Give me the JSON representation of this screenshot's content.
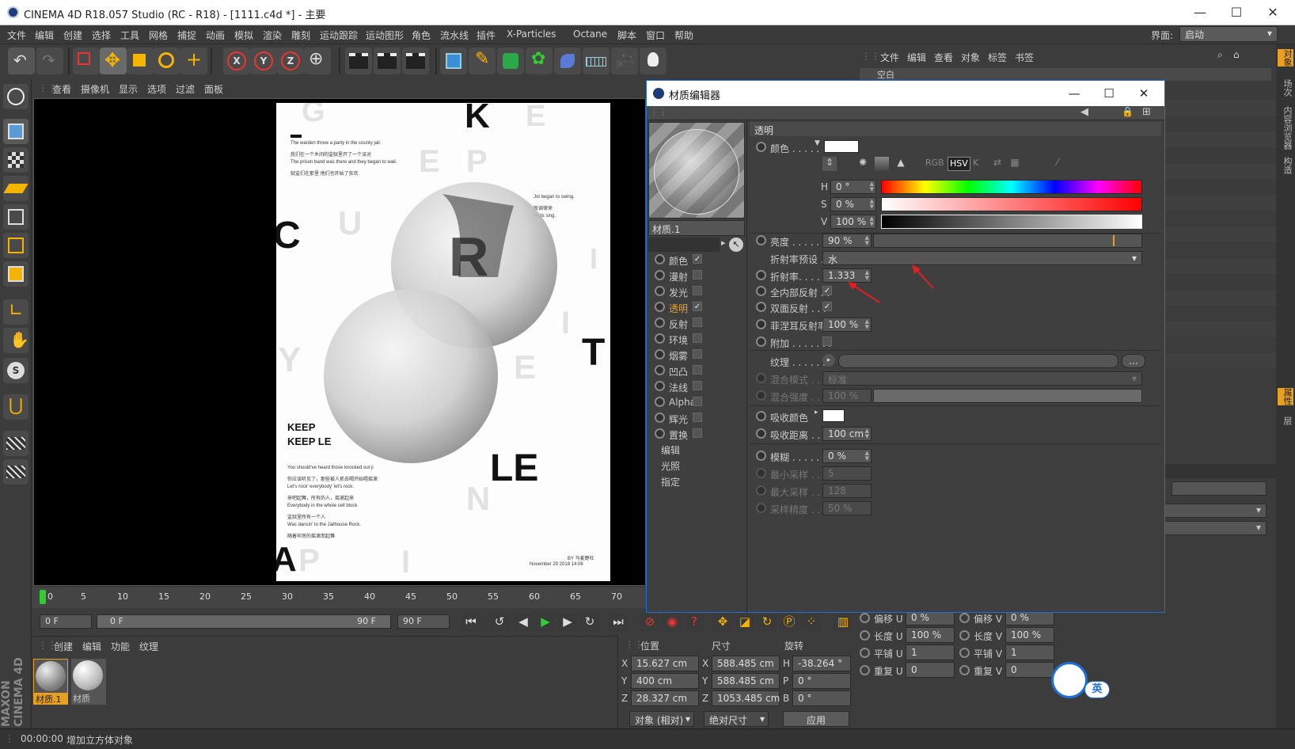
{
  "app": {
    "title": "CINEMA 4D R18.057 Studio (RC - R18) - [1111.c4d *] - 主要",
    "min": "—",
    "max": "☐",
    "close": "✕"
  },
  "menu": [
    "文件",
    "编辑",
    "创建",
    "选择",
    "工具",
    "网格",
    "捕捉",
    "动画",
    "模拟",
    "渲染",
    "雕刻",
    "运动跟踪",
    "运动图形",
    "角色",
    "流水线",
    "插件",
    "X-Particles",
    "Octane",
    "脚本",
    "窗口",
    "帮助"
  ],
  "layout": {
    "label": "界面:",
    "value": "启动"
  },
  "viewport_menu": [
    "查看",
    "摄像机",
    "显示",
    "选项",
    "过滤",
    "面板"
  ],
  "poster": {
    "small_text_1": [
      "The warden threw a party in the county jail.",
      "我们在一个乡间的监狱里开了一个派对",
      "The prison band was there and they began to wail.",
      "狱监们在那里 他们也开始了狂欢"
    ],
    "small_text_2": [
      "Jot began to swing.",
      "般调律来",
      "Birds sing."
    ],
    "headline": [
      "KEEP",
      "KEEP LE"
    ],
    "small_text_3": [
      "You should've heard those knocked out ji",
      "你应该听见了，那些被人抓去喝开始唱摇滚",
      "Let's rock' everybody' let's rock.",
      "来吧起舞，所有的人，摇滚起来",
      "Everybody in the whole cell block",
      "监狱里所有一个人",
      "Was dancin' to the Jailhouse Rock.",
      "随着牢房的摇滚而起舞"
    ],
    "credit": [
      "BY 马麦野社",
      "November 29 2018 14:06"
    ],
    "letters_dark": [
      "K",
      "C",
      "R",
      "T",
      "LE"
    ],
    "letters_light": [
      "G",
      "E",
      "E",
      "P",
      "U",
      "Y",
      "E",
      "N",
      "I",
      "A",
      "P",
      "I",
      "I"
    ]
  },
  "timeline": {
    "ticks": [
      "0",
      "5",
      "10",
      "15",
      "20",
      "25",
      "30",
      "35",
      "40",
      "45",
      "50",
      "55",
      "60",
      "65",
      "70"
    ],
    "current_frame": "0 F",
    "range_start": "0 F",
    "range_end": "90 F",
    "end_frame": "90 F"
  },
  "material_manager": {
    "menu": [
      "创建",
      "编辑",
      "功能",
      "纹理"
    ],
    "materials": [
      "材质.1",
      "材质"
    ]
  },
  "coords": {
    "headers": [
      "位置",
      "尺寸",
      "旋转"
    ],
    "rows": [
      {
        "a": "X",
        "pos": "15.627 cm",
        "b": "X",
        "size": "588.485 cm",
        "c": "H",
        "rot": "-38.264 °"
      },
      {
        "a": "Y",
        "pos": "400 cm",
        "b": "Y",
        "size": "588.485 cm",
        "c": "P",
        "rot": "0 °"
      },
      {
        "a": "Z",
        "pos": "28.327 cm",
        "b": "Z",
        "size": "1053.485 cm",
        "c": "B",
        "rot": "0 °"
      }
    ],
    "mode": "对象 (相对)",
    "size_mode": "绝对尺寸",
    "apply": "应用"
  },
  "status": {
    "time": "00:00:00",
    "message": "增加立方体对象"
  },
  "object_manager": {
    "menu": [
      "文件",
      "编辑",
      "查看",
      "对象",
      "标签",
      "书签"
    ],
    "item": "空白"
  },
  "uv": {
    "rows": [
      {
        "l1": "偏移 U",
        "v1": "0 %",
        "l2": "偏移 V",
        "v2": "0 %"
      },
      {
        "l1": "长度 U",
        "v1": "100 %",
        "l2": "长度 V",
        "v2": "100 %"
      },
      {
        "l1": "平铺 U",
        "v1": "1",
        "l2": "平铺 V",
        "v2": "1"
      },
      {
        "l1": "重复 U",
        "v1": "0",
        "l2": "重复 V",
        "v2": "0"
      }
    ],
    "ime": "英"
  },
  "right_tabs": [
    "对象",
    "场次",
    "内容浏览器",
    "构造",
    "属性",
    "层"
  ],
  "dialog": {
    "title": "材质编辑器",
    "material_name": "材质.1",
    "channels": [
      {
        "name": "颜色",
        "checked": true
      },
      {
        "name": "漫射",
        "checked": false
      },
      {
        "name": "发光",
        "checked": false
      },
      {
        "name": "透明",
        "checked": true,
        "active": true
      },
      {
        "name": "反射",
        "checked": false
      },
      {
        "name": "环境",
        "checked": false
      },
      {
        "name": "烟雾",
        "checked": false
      },
      {
        "name": "凹凸",
        "checked": false
      },
      {
        "name": "法线",
        "checked": false
      },
      {
        "name": "Alpha",
        "checked": false
      },
      {
        "name": "辉光",
        "checked": false
      },
      {
        "name": "置换",
        "checked": false
      }
    ],
    "extra": [
      "编辑",
      "光照",
      "指定"
    ],
    "section": "透明",
    "color_label": "颜色 . . . . .",
    "h": {
      "label": "H",
      "value": "0 °"
    },
    "s": {
      "label": "S",
      "value": "0 %"
    },
    "v": {
      "label": "V",
      "value": "100 %"
    },
    "brightness": {
      "label": "亮度 . . . . . . .",
      "value": "90 %",
      "level": 0.9
    },
    "ior_preset": {
      "label": "折射率预设 . .",
      "value": "水"
    },
    "ior": {
      "label": "折射率. . . . . .",
      "value": "1.333"
    },
    "total_internal": {
      "label": "全内部反射 . .",
      "checked": true
    },
    "double_sided": {
      "label": "双面反射 . . .",
      "checked": true
    },
    "fresnel": {
      "label": "菲涅耳反射率",
      "value": "100 %"
    },
    "additive": {
      "label": "附加 . . . . . . .",
      "checked": false
    },
    "texture": {
      "label": "纹理 . . . . . . .",
      "btn": "..."
    },
    "mix_mode": {
      "label": "混合模式 . . . .",
      "value": "标准"
    },
    "mix_strength": {
      "label": "混合强度 . . . .",
      "value": "100 %"
    },
    "absorb_color": {
      "label": "吸收颜色"
    },
    "absorb_dist": {
      "label": "吸收距离 . . . .",
      "value": "100 cm"
    },
    "blur": {
      "label": "模糊 . . . . . . .",
      "value": "0 %"
    },
    "min_samples": {
      "label": "最小采样 . . . .",
      "value": "5"
    },
    "max_samples": {
      "label": "最大采样 . . . .",
      "value": "128"
    },
    "accuracy": {
      "label": "采样精度 . . . .",
      "value": "50 %"
    },
    "color_buttons": [
      "RGB",
      "HSV",
      "K"
    ],
    "accent": "#e8a020"
  }
}
